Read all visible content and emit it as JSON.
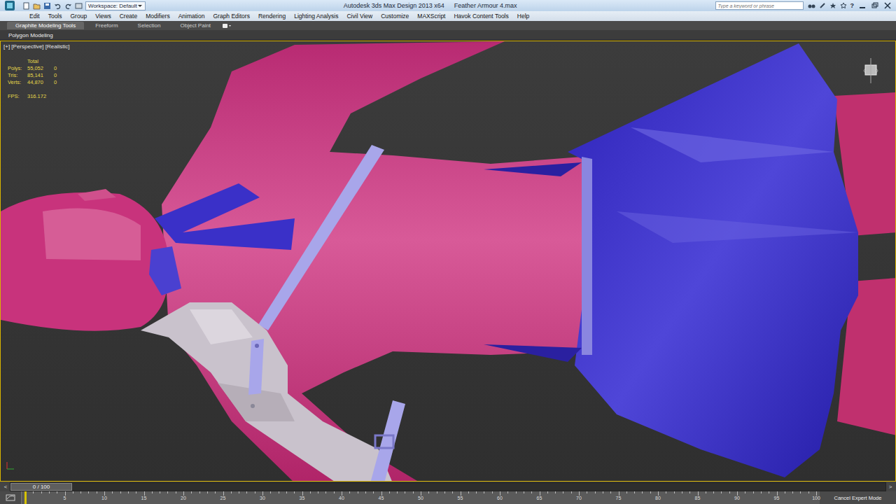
{
  "window": {
    "title": "Autodesk 3ds Max Design 2013 x64",
    "file": "Feather Armour 4.max"
  },
  "workspace": {
    "label": "Workspace: Default"
  },
  "search": {
    "placeholder": "Type a keyword or phrase"
  },
  "help": "?",
  "menu": [
    "Edit",
    "Tools",
    "Group",
    "Views",
    "Create",
    "Modifiers",
    "Animation",
    "Graph Editors",
    "Rendering",
    "Lighting Analysis",
    "Civil View",
    "Customize",
    "MAXScript",
    "Havok Content Tools",
    "Help"
  ],
  "ribbon": {
    "tabs": [
      {
        "label": "Graphite Modeling Tools",
        "selected": true
      },
      {
        "label": "Freeform",
        "selected": false
      },
      {
        "label": "Selection",
        "selected": false
      },
      {
        "label": "Object Paint",
        "selected": false
      }
    ],
    "panel": "Polygon Modeling"
  },
  "viewport": {
    "label": "[+] [Perspective] [Realistic]",
    "stats": {
      "header": "Total",
      "rows": [
        {
          "label": "Polys:",
          "total": "55,052",
          "selection": "0"
        },
        {
          "label": "Tris:",
          "total": "85,141",
          "selection": "0"
        },
        {
          "label": "Verts:",
          "total": "44,870",
          "selection": "0"
        }
      ],
      "fps_label": "FPS:",
      "fps": "316.172"
    }
  },
  "timeline": {
    "position": "0 / 100",
    "prev": "<",
    "next": ">",
    "level": 0,
    "ticks": [
      "5",
      "10",
      "15",
      "20",
      "25",
      "30",
      "35",
      "40",
      "45",
      "50",
      "55",
      "60",
      "65",
      "70",
      "75",
      "80",
      "85",
      "90",
      "95",
      "100"
    ]
  },
  "status": {
    "button": "Cancel Expert Mode"
  }
}
